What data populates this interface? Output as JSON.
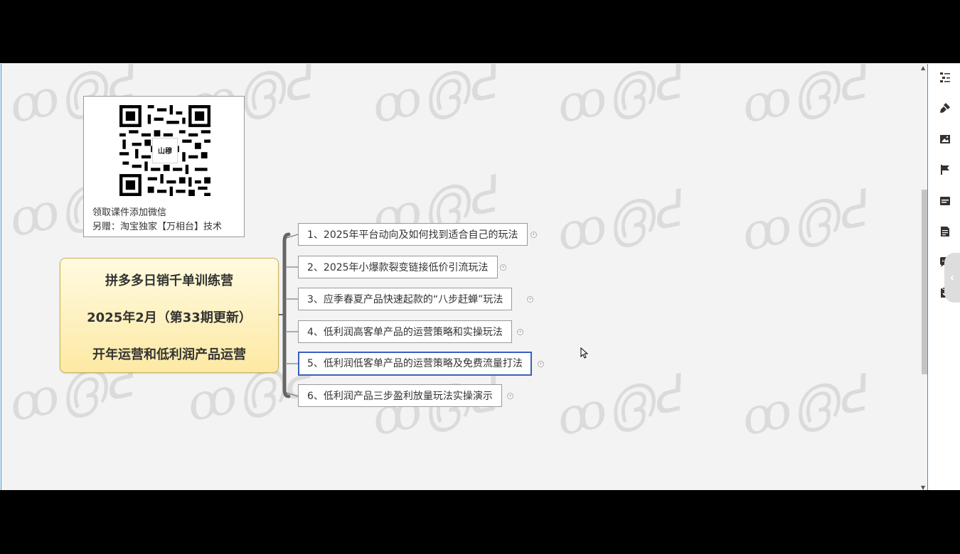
{
  "qr_card": {
    "caption_line1": "领取课件添加微信",
    "caption_line2": "另赠：淘宝独家【万相台】技术",
    "qr_center_text": "山穆"
  },
  "root_topic": {
    "line1": "拼多多日销千单训练营",
    "line2": "2025年2月（第33期更新）",
    "line3": "开年运营和低利润产品运营"
  },
  "subtopics": [
    {
      "label": "1、2025年平台动向及如何找到适合自己的玩法"
    },
    {
      "label": "2、2025年小爆款裂变链接低价引流玩法"
    },
    {
      "label": "3、应季春夏产品快速起款的“八步赶蝉”玩法"
    },
    {
      "label": "4、低利润高客单产品的运营策略和实操玩法"
    },
    {
      "label": "5、低利润低客单产品的运营策略及免费流量打法",
      "selected": true
    },
    {
      "label": "6、低利润产品三步盈利放量玩法实操演示"
    }
  ],
  "right_panel": {
    "icons": [
      "outline-icon",
      "format-brush-icon",
      "image-icon",
      "flag-icon",
      "label-icon",
      "note-icon",
      "comment-icon",
      "task-icon"
    ],
    "collapse_icon": "chevron-left-icon"
  },
  "colors": {
    "root_gradient_top": "#fffbe1",
    "root_gradient_bottom": "#fde9a3",
    "selection_border": "#3a5fc2",
    "branch_line": "#666666",
    "window_border": "#3b8fd6"
  }
}
